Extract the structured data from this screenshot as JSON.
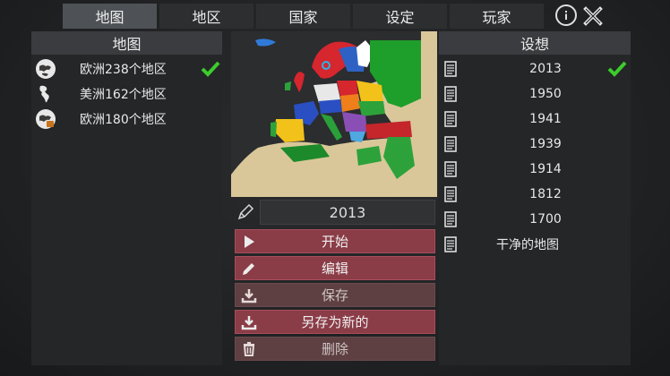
{
  "tabs": [
    {
      "label": "地图",
      "active": true
    },
    {
      "label": "地区",
      "active": false
    },
    {
      "label": "国家",
      "active": false
    },
    {
      "label": "设定",
      "active": false
    },
    {
      "label": "玩家",
      "active": false
    }
  ],
  "icons": {
    "info": "info-icon",
    "close": "close-icon"
  },
  "maps_panel": {
    "title": "地图",
    "items": [
      {
        "label": "欧洲238个地区",
        "icon": "globe-europe-icon",
        "selected": true
      },
      {
        "label": "美洲162个地区",
        "icon": "globe-americas-icon",
        "selected": false
      },
      {
        "label": "欧洲180个地区",
        "icon": "globe-europe-icon",
        "selected": false
      }
    ]
  },
  "scenario_editor": {
    "year": "2013",
    "actions": [
      {
        "label": "开始",
        "icon": "play-icon",
        "enabled": true
      },
      {
        "label": "编辑",
        "icon": "pencil-icon",
        "enabled": true
      },
      {
        "label": "保存",
        "icon": "download-icon",
        "enabled": false
      },
      {
        "label": "另存为新的",
        "icon": "download-icon",
        "enabled": true
      },
      {
        "label": "删除",
        "icon": "trash-icon",
        "enabled": false
      }
    ]
  },
  "scenarios_panel": {
    "title": "设想",
    "items": [
      {
        "label": "2013",
        "selected": true
      },
      {
        "label": "1950",
        "selected": false
      },
      {
        "label": "1941",
        "selected": false
      },
      {
        "label": "1939",
        "selected": false
      },
      {
        "label": "1914",
        "selected": false
      },
      {
        "label": "1812",
        "selected": false
      },
      {
        "label": "1700",
        "selected": false
      },
      {
        "label": "干净的地图",
        "selected": false
      }
    ]
  },
  "colors": {
    "accent_button": "#8a3c47",
    "disabled_button": "#5e4042",
    "check": "#3ccc2c",
    "tab_active": "#4e5256"
  }
}
